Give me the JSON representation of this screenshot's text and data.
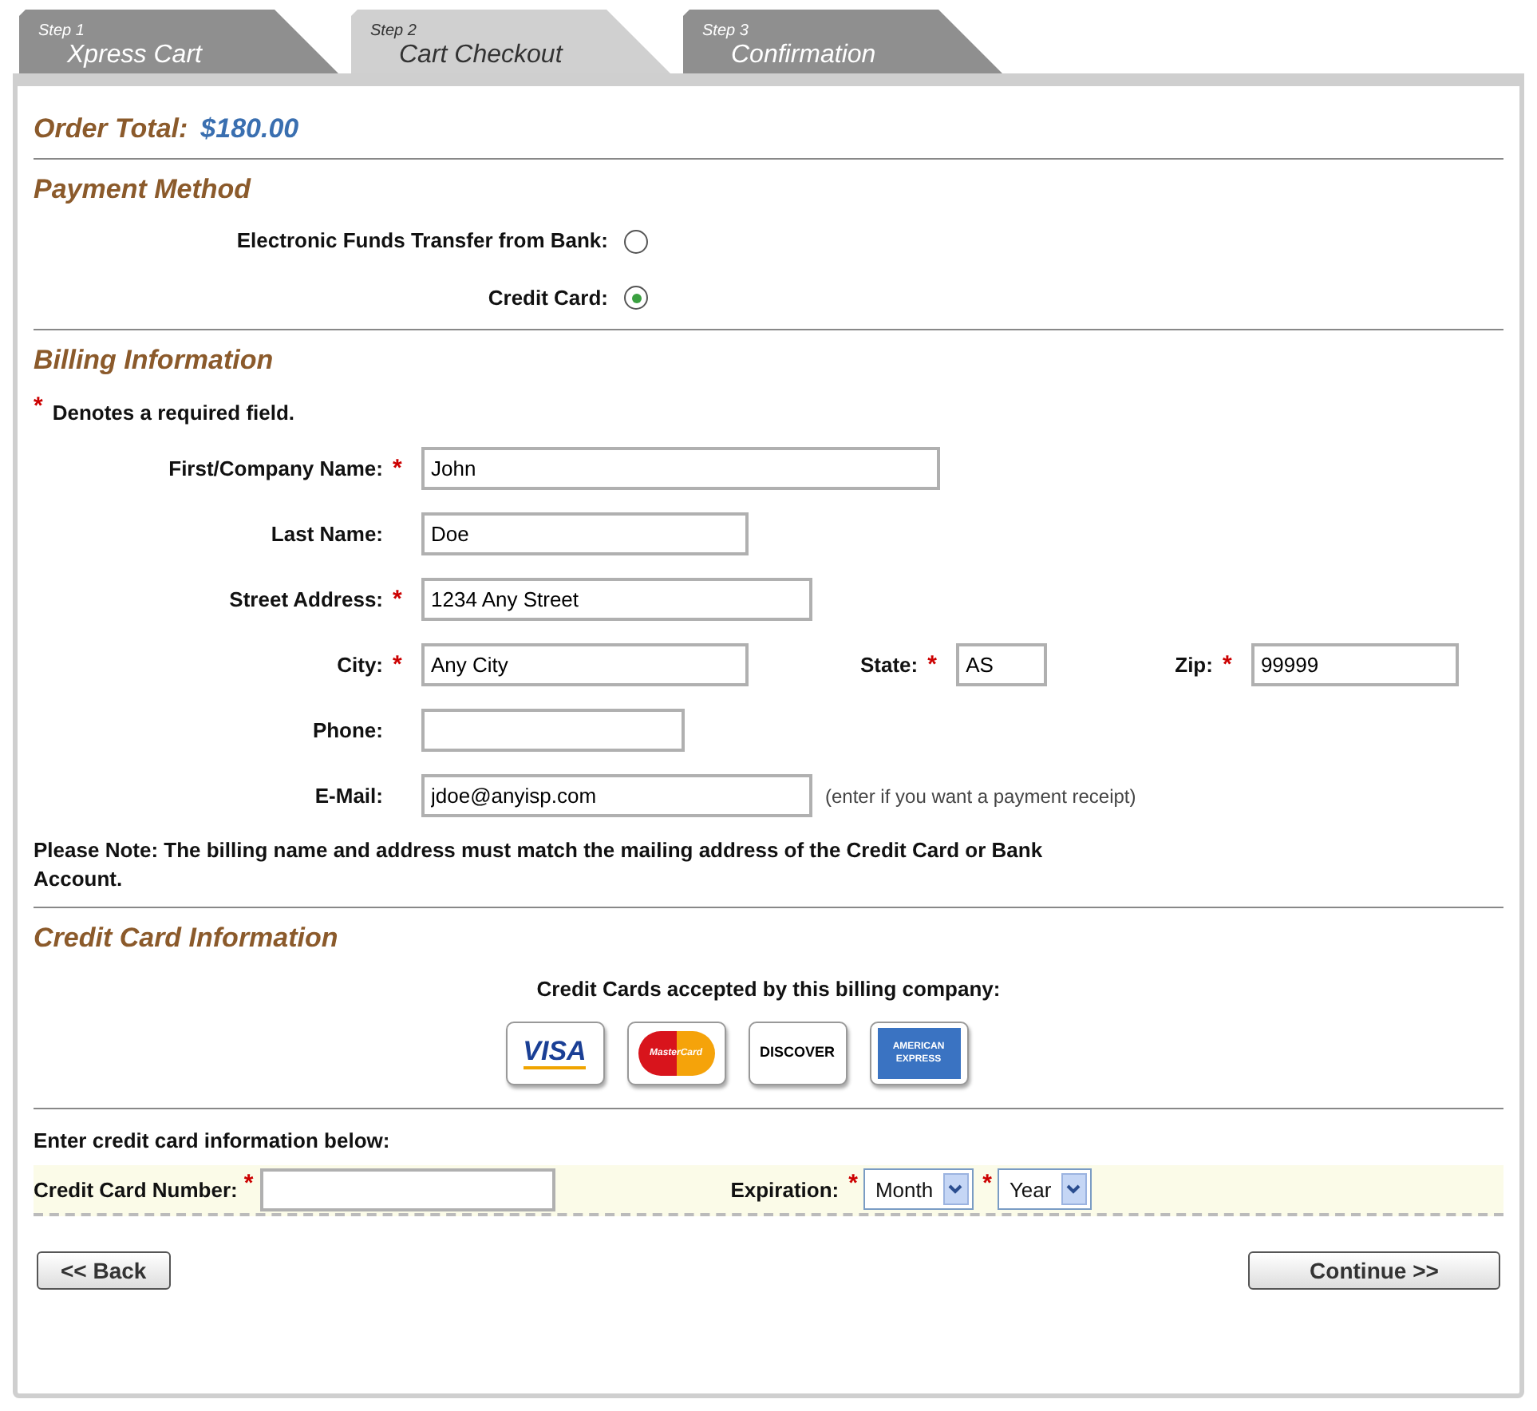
{
  "tabs": [
    {
      "step": "Step 1",
      "label": "Xpress Cart",
      "selected": false
    },
    {
      "step": "Step 2",
      "label": "Cart Checkout",
      "selected": true
    },
    {
      "step": "Step 3",
      "label": "Confirmation",
      "selected": false
    }
  ],
  "order_total": {
    "label": "Order Total:",
    "value": "$180.00"
  },
  "payment_method": {
    "title": "Payment Method",
    "options": [
      {
        "label": "Electronic Funds Transfer from Bank:",
        "selected": false
      },
      {
        "label": "Credit Card:",
        "selected": true
      }
    ]
  },
  "billing": {
    "title": "Billing Information",
    "required_note": {
      "mark": "*",
      "text": "Denotes a required field."
    },
    "rows": [
      [
        {
          "label": "First/Company Name:",
          "mark": "*",
          "value": "John"
        }
      ],
      [
        {
          "label": "Last Name:",
          "value": "Doe"
        }
      ],
      [
        {
          "label": "Street Address:",
          "mark": "*",
          "value": "1234 Any Street"
        }
      ],
      [
        {
          "label": "City:",
          "mark": "*",
          "value": "Any City"
        },
        {
          "label": "State:",
          "mark": "*",
          "value": "AS"
        },
        {
          "label": "Zip:",
          "mark": "*",
          "value": "99999"
        }
      ],
      [
        {
          "label": "Phone:"
        }
      ],
      [
        {
          "label": "E-Mail:",
          "value": "jdoe@anyisp.com",
          "hint": "(enter if you want a payment receipt)"
        }
      ]
    ],
    "note": "Please Note: The billing name and address must match the mailing address of the Credit Card or Bank Account."
  },
  "credit_card": {
    "title": "Credit Card Information",
    "accepted_text": "Credit Cards accepted by this billing company:",
    "cards": [
      {
        "kind": "visa",
        "label": "VISA"
      },
      {
        "kind": "mastercard",
        "label": "MasterCard"
      },
      {
        "kind": "discover",
        "label": "DISCOVER"
      },
      {
        "kind": "amex",
        "label": "AMERICAN EXPRESS"
      }
    ],
    "enter_text": "Enter credit card information below:",
    "number": {
      "label": "Credit Card Number:",
      "mark": "*"
    },
    "expiration": {
      "label": "Expiration:",
      "selects": [
        {
          "mark": "*",
          "value": "Month"
        },
        {
          "mark": "*",
          "value": "Year"
        }
      ]
    }
  },
  "buttons": {
    "back": "<< Back",
    "continue": "Continue >>"
  }
}
